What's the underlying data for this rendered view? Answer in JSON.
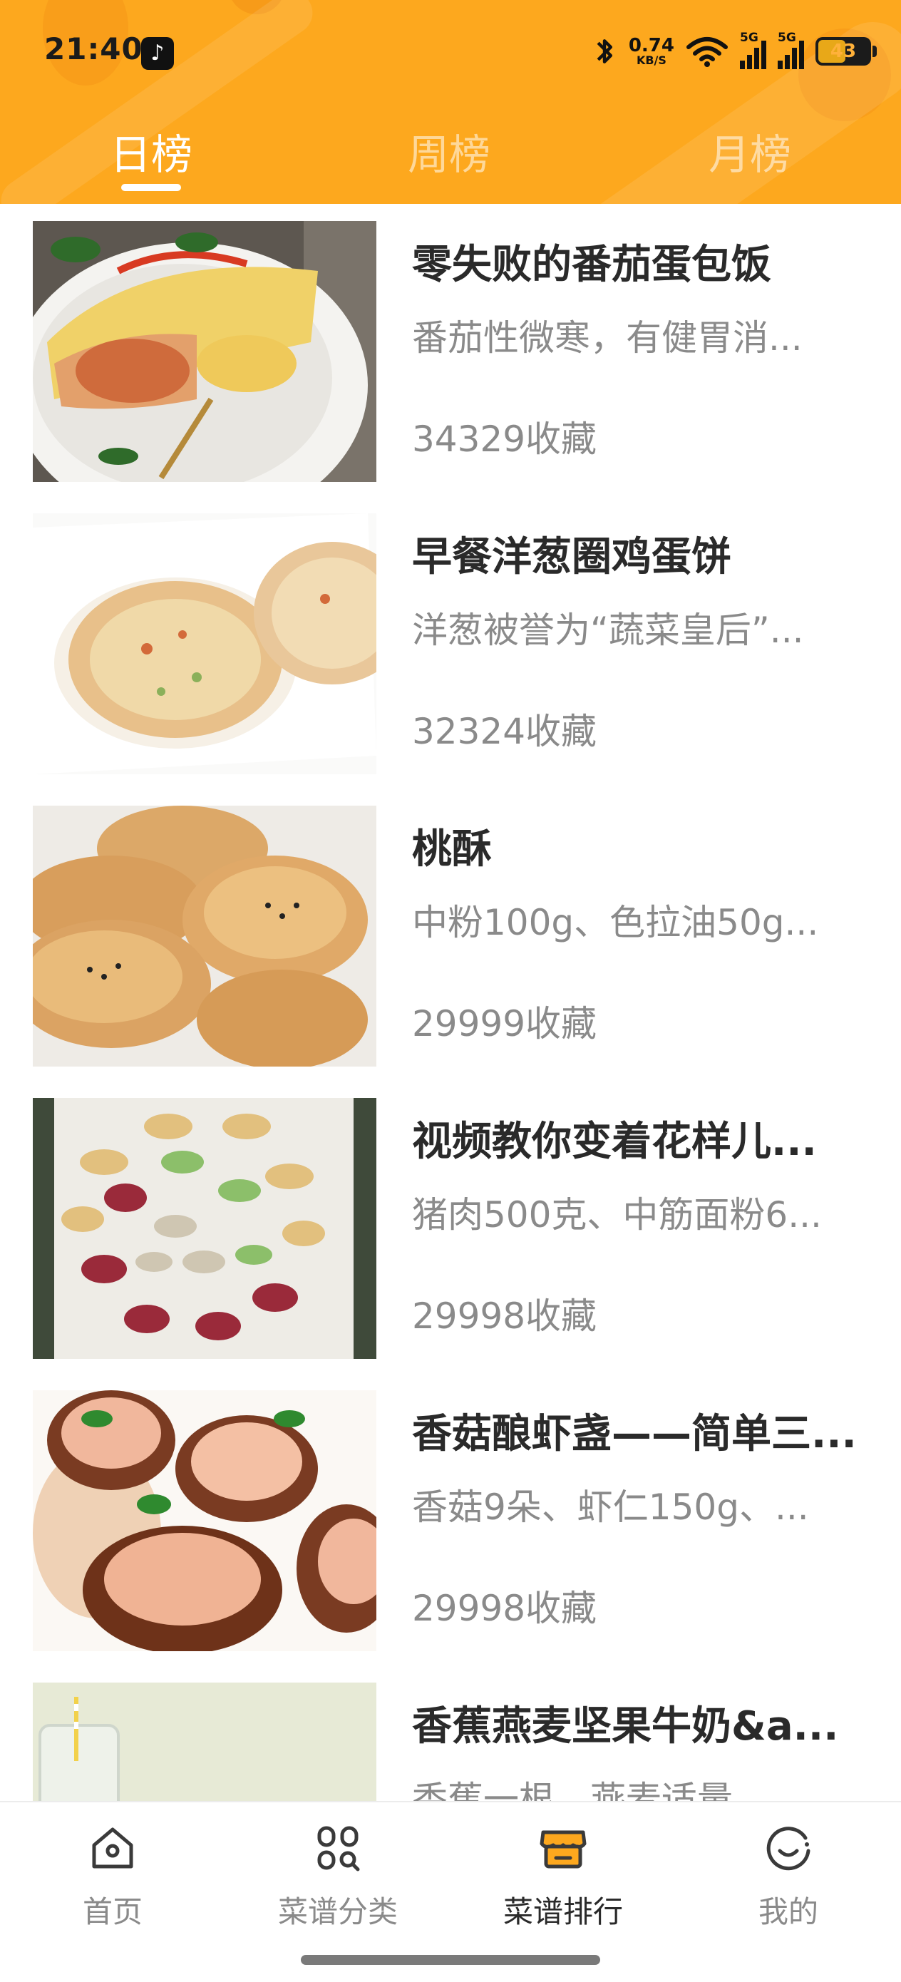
{
  "status_bar": {
    "time": "21:40",
    "network_speed": "0.74",
    "network_unit": "KB/S",
    "signal_1_label": "5G",
    "signal_2_label": "5G",
    "battery_level": "43",
    "icons": [
      "tiktok-icon",
      "bluetooth-icon",
      "wifi-icon",
      "signal-icon",
      "battery-icon"
    ]
  },
  "tabs": [
    {
      "label": "日榜",
      "active": true
    },
    {
      "label": "周榜",
      "active": false
    },
    {
      "label": "月榜",
      "active": false
    }
  ],
  "recipes": [
    {
      "title": "零失败的番茄蛋包饭",
      "desc": "番茄性微寒，有健胃消...",
      "favorites": "34329收藏"
    },
    {
      "title": "早餐洋葱圈鸡蛋饼",
      "desc": "洋葱被誉为“蔬菜皇后”...",
      "favorites": "32324收藏"
    },
    {
      "title": "桃酥",
      "desc": "中粉100g、色拉油50g...",
      "favorites": "29999收藏"
    },
    {
      "title": "视频教你变着花样儿...",
      "desc": "猪肉500克、中筋面粉6...",
      "favorites": "29998收藏"
    },
    {
      "title": "香菇酿虾盏——简单三...",
      "desc": "香菇9朵、虾仁150g、...",
      "favorites": "29998收藏"
    },
    {
      "title": "香蕉燕麦坚果牛奶&a...",
      "desc": "香蕉一根、燕麦适量...",
      "favorites": ""
    }
  ],
  "bottom_nav": [
    {
      "label": "首页",
      "icon": "home-icon",
      "active": false
    },
    {
      "label": "菜谱分类",
      "icon": "category-icon",
      "active": false
    },
    {
      "label": "菜谱排行",
      "icon": "ranking-shop-icon",
      "active": true
    },
    {
      "label": "我的",
      "icon": "profile-smile-icon",
      "active": false
    }
  ],
  "colors": {
    "header_bg": "#FDA81E",
    "active_accent": "#FDA81E",
    "title_text": "#2a2a2a",
    "secondary_text": "#8a8a8a"
  }
}
